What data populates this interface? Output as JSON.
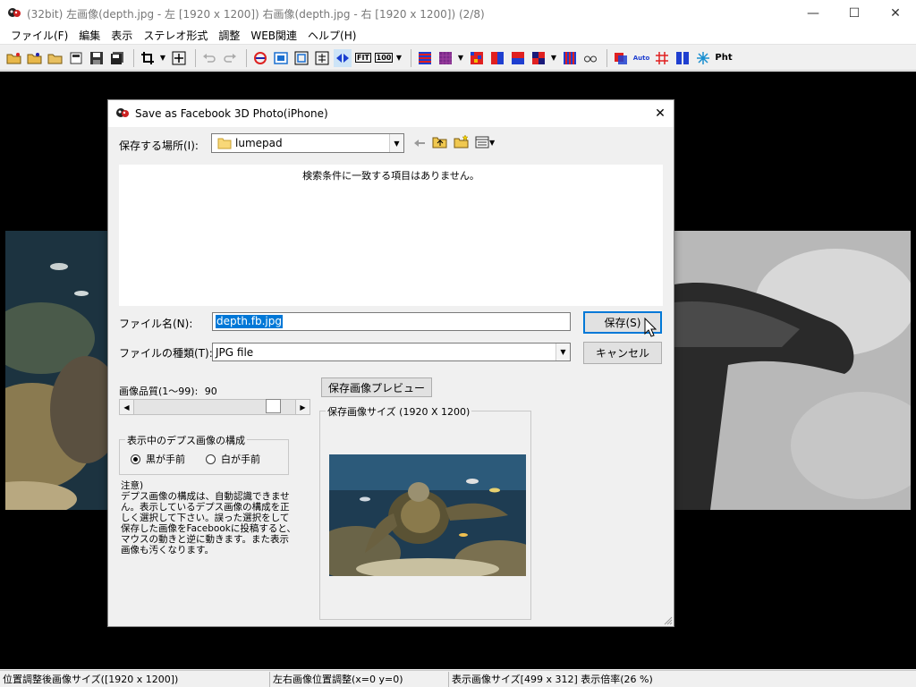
{
  "window": {
    "title": "(32bit) 左画像(depth.jpg - 左 [1920 x 1200]) 右画像(depth.jpg - 右 [1920 x 1200])  (2/8)",
    "minimize_glyph": "—",
    "maximize_glyph": "☐",
    "close_glyph": "✕"
  },
  "menu": [
    {
      "label": "ファイル(F)"
    },
    {
      "label": "編集"
    },
    {
      "label": "表示"
    },
    {
      "label": "ステレオ形式"
    },
    {
      "label": "調整"
    },
    {
      "label": "WEB関連"
    },
    {
      "label": "ヘルプ(H)"
    }
  ],
  "toolbar": {
    "fit_label": "FIT",
    "zoom100_label": "100",
    "auto_label": "Auto",
    "pht_label": "Pht",
    "colors": {
      "red": "#e02020",
      "blue": "#1f3fd0",
      "purple": "#7a2a8a",
      "navy": "#1a1a7a"
    }
  },
  "dialog": {
    "title": "Save as Facebook 3D Photo(iPhone)",
    "close_glyph": "✕",
    "save_in_label": "保存する場所(I):",
    "save_in_value": "lumepad",
    "empty_message": "検索条件に一致する項目はありません。",
    "filename_label": "ファイル名(N):",
    "filename_value": "depth.fb.jpg",
    "filetype_label": "ファイルの種類(T):",
    "filetype_value": "JPG file",
    "save_button": "保存(S)",
    "cancel_button": "キャンセル",
    "quality_label": "画像品質(1〜99):",
    "quality_value": "90",
    "quality_level": 0.9,
    "preview_button": "保存画像プレビュー",
    "preview_group_label": "保存画像サイズ (1920 X 1200)",
    "depth_group_label": "表示中のデプス画像の構成",
    "radio_black_front": "黒が手前",
    "radio_white_front": "白が手前",
    "selected_radio": "black",
    "note_title": "注意)",
    "note_text": "デプス画像の構成は、自動認識できません。表示しているデプス画像の構成を正しく選択して下さい。誤った選択をして保存した画像をFacebookに投稿すると、マウスの動きと逆に動きます。また表示画像も汚くなります。"
  },
  "status": {
    "cell1": "位置調整後画像サイズ([1920 x 1200])",
    "cell2": "左右画像位置調整(x=0 y=0)",
    "cell3": "表示画像サイズ[499 x 312]  表示倍率(26 %)"
  }
}
